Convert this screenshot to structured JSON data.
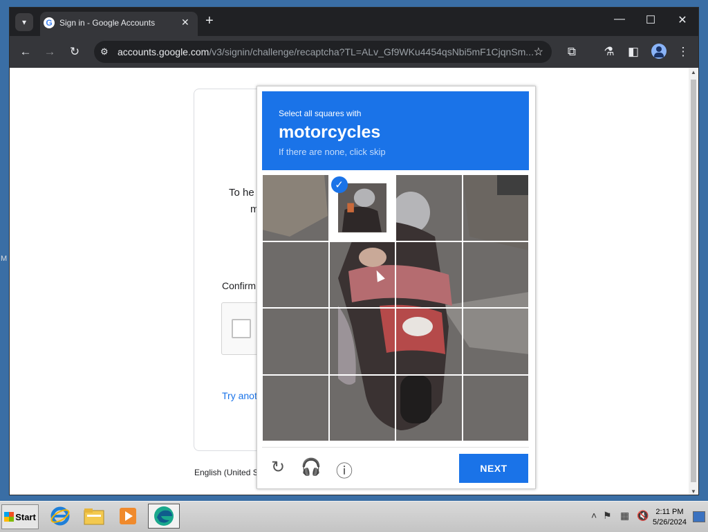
{
  "browser": {
    "tab_menu_icon": "chevron-down-icon",
    "tab_title": "Sign in - Google Accounts",
    "favicon_letter": "G",
    "new_tab_icon": "plus-icon",
    "url_domain": "accounts.google.com",
    "url_path": "/v3/signin/challenge/recaptcha?TL=ALv_Gf9WKu4454qsNbi5mF1CjqnSm...",
    "window_controls": [
      "minimize",
      "maximize",
      "close"
    ]
  },
  "google_page": {
    "text_partial_1": "To he",
    "text_partial_2": "m",
    "confirm_partial": "Confirm",
    "try_another_partial": "Try anot",
    "language_partial": "English (United S"
  },
  "captcha": {
    "instruction": "Select all squares with",
    "target": "motorcycles",
    "hint": "If there are none, click skip",
    "next_label": "NEXT",
    "grid_size": 4,
    "selected_tiles": [
      1
    ],
    "colors": {
      "accent": "#1a73e8"
    }
  },
  "taskbar": {
    "start_label": "Start",
    "time": "2:11 PM",
    "date": "5/26/2024"
  },
  "desktop": {
    "side_letter": "M"
  }
}
